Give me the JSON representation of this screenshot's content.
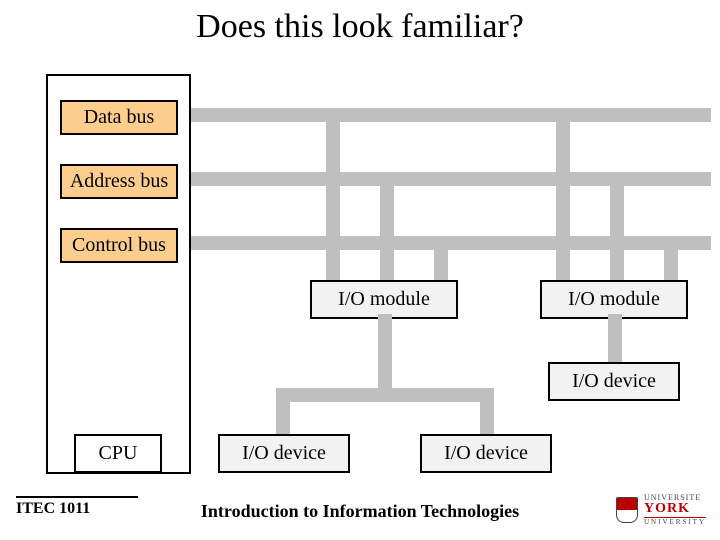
{
  "title": "Does this look familiar?",
  "buses": {
    "data": {
      "label": "Data bus"
    },
    "address": {
      "label": "Address bus"
    },
    "control": {
      "label": "Control bus"
    }
  },
  "modules": {
    "io_module_1": "I/O module",
    "io_module_2": "I/O module",
    "io_device_1": "I/O device",
    "io_device_2": "I/O device",
    "io_device_3": "I/O device",
    "cpu": "CPU"
  },
  "footer": {
    "course_code": "ITEC 1011",
    "subtitle": "Introduction to Information Technologies",
    "logo_top": "UNIVERSITE",
    "logo_mid": "YORK",
    "logo_bot": "UNIVERSITY"
  },
  "colors": {
    "bus_fill": "#fccd8c",
    "connector": "#bfbfbf",
    "module_fill": "#f2f2f2",
    "logo_red": "#b00"
  }
}
